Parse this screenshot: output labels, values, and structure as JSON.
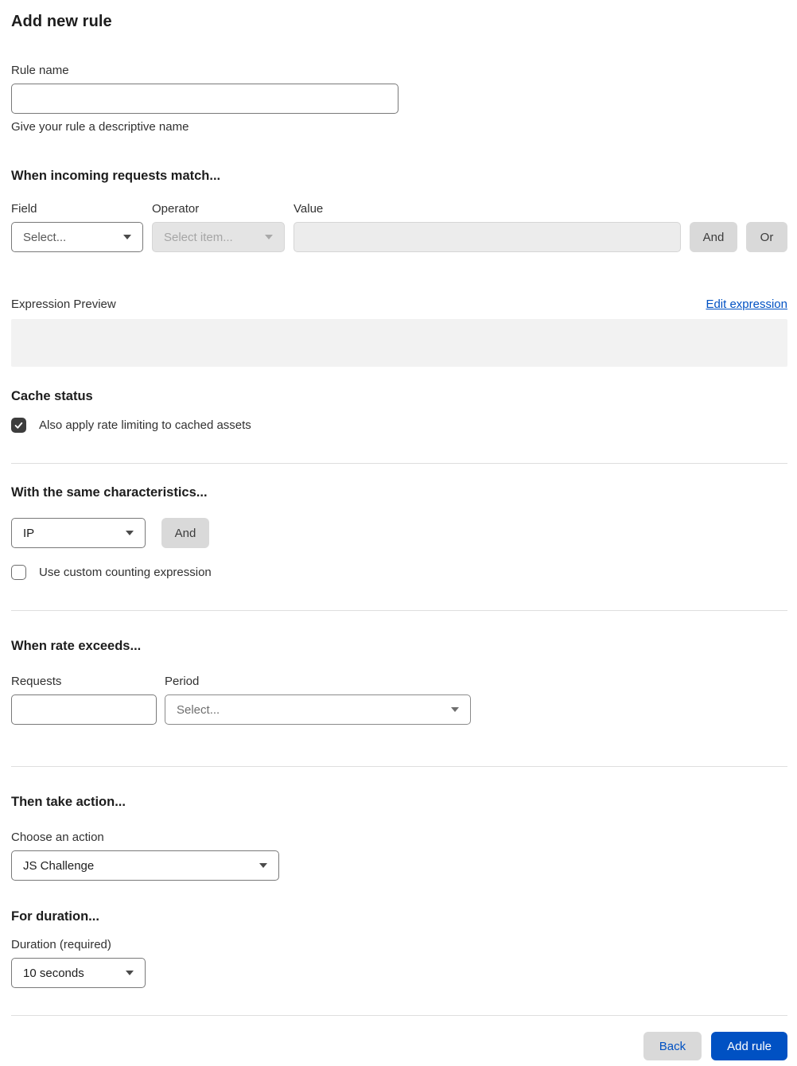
{
  "page": {
    "title": "Add new rule"
  },
  "colors": {
    "accent_blue": "#0051c3",
    "gray_button": "#d9d9d9",
    "checkbox_checked": "#3d3d3d",
    "expression_preview_bg": "#f2f2f2"
  },
  "rule_name": {
    "label": "Rule name",
    "value": "",
    "helper": "Give your rule a descriptive name"
  },
  "match_section": {
    "heading": "When incoming requests match...",
    "field": {
      "label": "Field",
      "selected": "Select...",
      "disabled": false
    },
    "operator": {
      "label": "Operator",
      "selected": "Select item...",
      "disabled": true
    },
    "value": {
      "label": "Value",
      "value": "",
      "disabled": true
    },
    "and_button": "And",
    "or_button": "Or",
    "expression_preview_label": "Expression Preview",
    "edit_expression_link": "Edit expression",
    "expression_value": ""
  },
  "cache_section": {
    "heading": "Cache status",
    "checkbox_label": "Also apply rate limiting to cached assets",
    "checked": true
  },
  "characteristics_section": {
    "heading": "With the same characteristics...",
    "characteristic": {
      "selected": "IP"
    },
    "and_button": "And",
    "checkbox_label": "Use custom counting expression",
    "checked": false
  },
  "rate_section": {
    "heading": "When rate exceeds...",
    "requests": {
      "label": "Requests",
      "value": ""
    },
    "period": {
      "label": "Period",
      "selected": "Select..."
    }
  },
  "action_section": {
    "heading": "Then take action...",
    "label": "Choose an action",
    "action": {
      "selected": "JS Challenge"
    }
  },
  "duration_section": {
    "heading": "For duration...",
    "label": "Duration (required)",
    "duration": {
      "selected": "10 seconds"
    }
  },
  "footer": {
    "back_button": "Back",
    "add_rule_button": "Add rule"
  }
}
